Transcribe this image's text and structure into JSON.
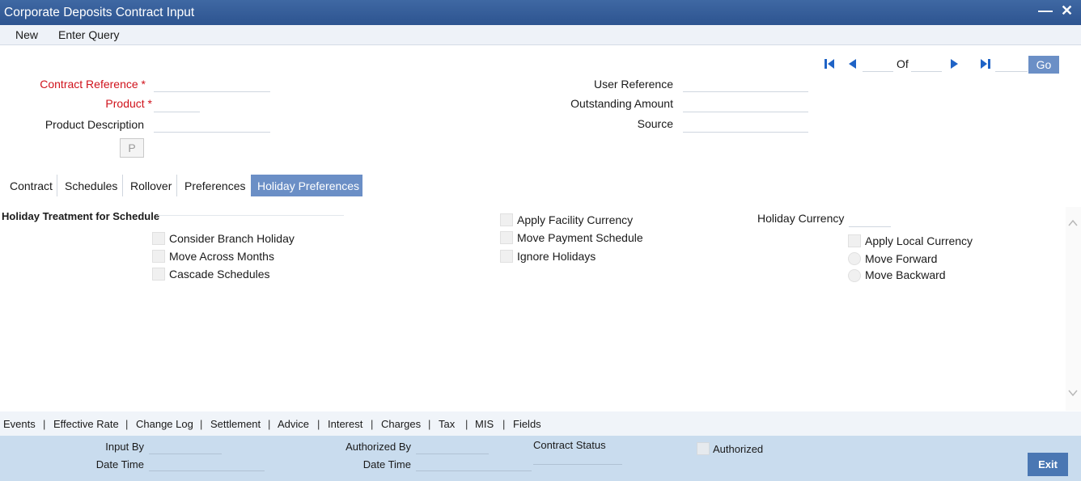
{
  "window": {
    "title": "Corporate Deposits Contract Input"
  },
  "menu": {
    "new": "New",
    "enter_query": "Enter Query"
  },
  "pager": {
    "of": "Of",
    "current": "",
    "total": "",
    "jump": "",
    "go": "Go"
  },
  "header": {
    "contract_reference": {
      "label": "Contract Reference",
      "value": ""
    },
    "product": {
      "label": "Product",
      "value": ""
    },
    "product_description": {
      "label": "Product Description",
      "value": ""
    },
    "p_button": "P",
    "user_reference": {
      "label": "User Reference",
      "value": ""
    },
    "outstanding_amount": {
      "label": "Outstanding Amount",
      "value": ""
    },
    "source": {
      "label": "Source",
      "value": ""
    },
    "required_marker": "*"
  },
  "tabs": [
    "Contract",
    "Schedules",
    "Rollover",
    "Preferences",
    "Holiday Preferences"
  ],
  "holiday": {
    "section_title": "Holiday Treatment for Schedule",
    "consider_branch_holiday": "Consider Branch Holiday",
    "move_across_months": "Move Across Months",
    "cascade_schedules": "Cascade Schedules",
    "apply_facility_currency": "Apply Facility Currency",
    "move_payment_schedule": "Move Payment Schedule",
    "ignore_holidays": "Ignore Holidays",
    "holiday_currency": {
      "label": "Holiday Currency",
      "value": ""
    },
    "apply_local_currency": "Apply Local Currency",
    "move_forward": "Move Forward",
    "move_backward": "Move Backward"
  },
  "links": [
    "Events",
    "Effective Rate",
    "Change Log",
    "Settlement",
    "Advice",
    "Interest",
    "Charges",
    "Tax",
    "MIS",
    "Fields"
  ],
  "link_separator": "|",
  "footer": {
    "input_by": "Input By",
    "date_time": "Date Time",
    "authorized_by": "Authorized By",
    "contract_status": "Contract Status",
    "authorized": "Authorized",
    "exit": "Exit"
  },
  "colors": {
    "title_bar": "#2d5490",
    "accent": "#6b8fc6",
    "footer": "#c9dcee",
    "required": "#d0121b"
  }
}
